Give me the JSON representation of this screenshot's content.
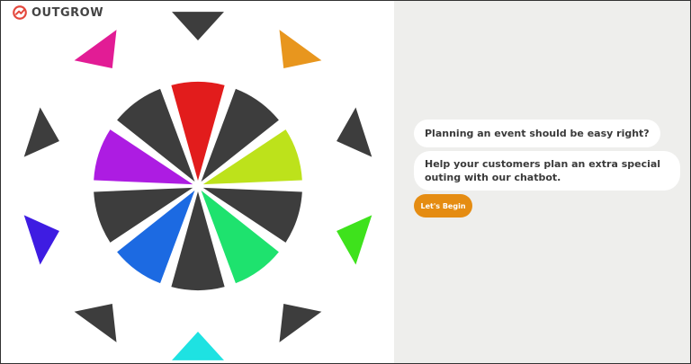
{
  "brand": {
    "name": "OUTGROW",
    "logo_color": "#e4473c"
  },
  "chat": {
    "messages": [
      "Planning an event should be easy right?",
      "Help your customers plan an extra special outing with our chatbot."
    ],
    "cta_label": "Let's Begin",
    "cta_color": "#e58c12"
  },
  "wheel": {
    "segment_colors": [
      "#e21c1c",
      "#3d3d3d",
      "#bde21b",
      "#3d3d3d",
      "#1ee26e",
      "#3d3d3d",
      "#1c6ae2",
      "#3d3d3d",
      "#ad1ce2",
      "#3d3d3d"
    ],
    "outer_triangle_colors": [
      "#3d3d3d",
      "#e8961e",
      "#3d3d3d",
      "#3ee21c",
      "#3d3d3d",
      "#1ee2e2",
      "#3d3d3d",
      "#3e1ce2",
      "#3d3d3d",
      "#e21c95"
    ]
  }
}
